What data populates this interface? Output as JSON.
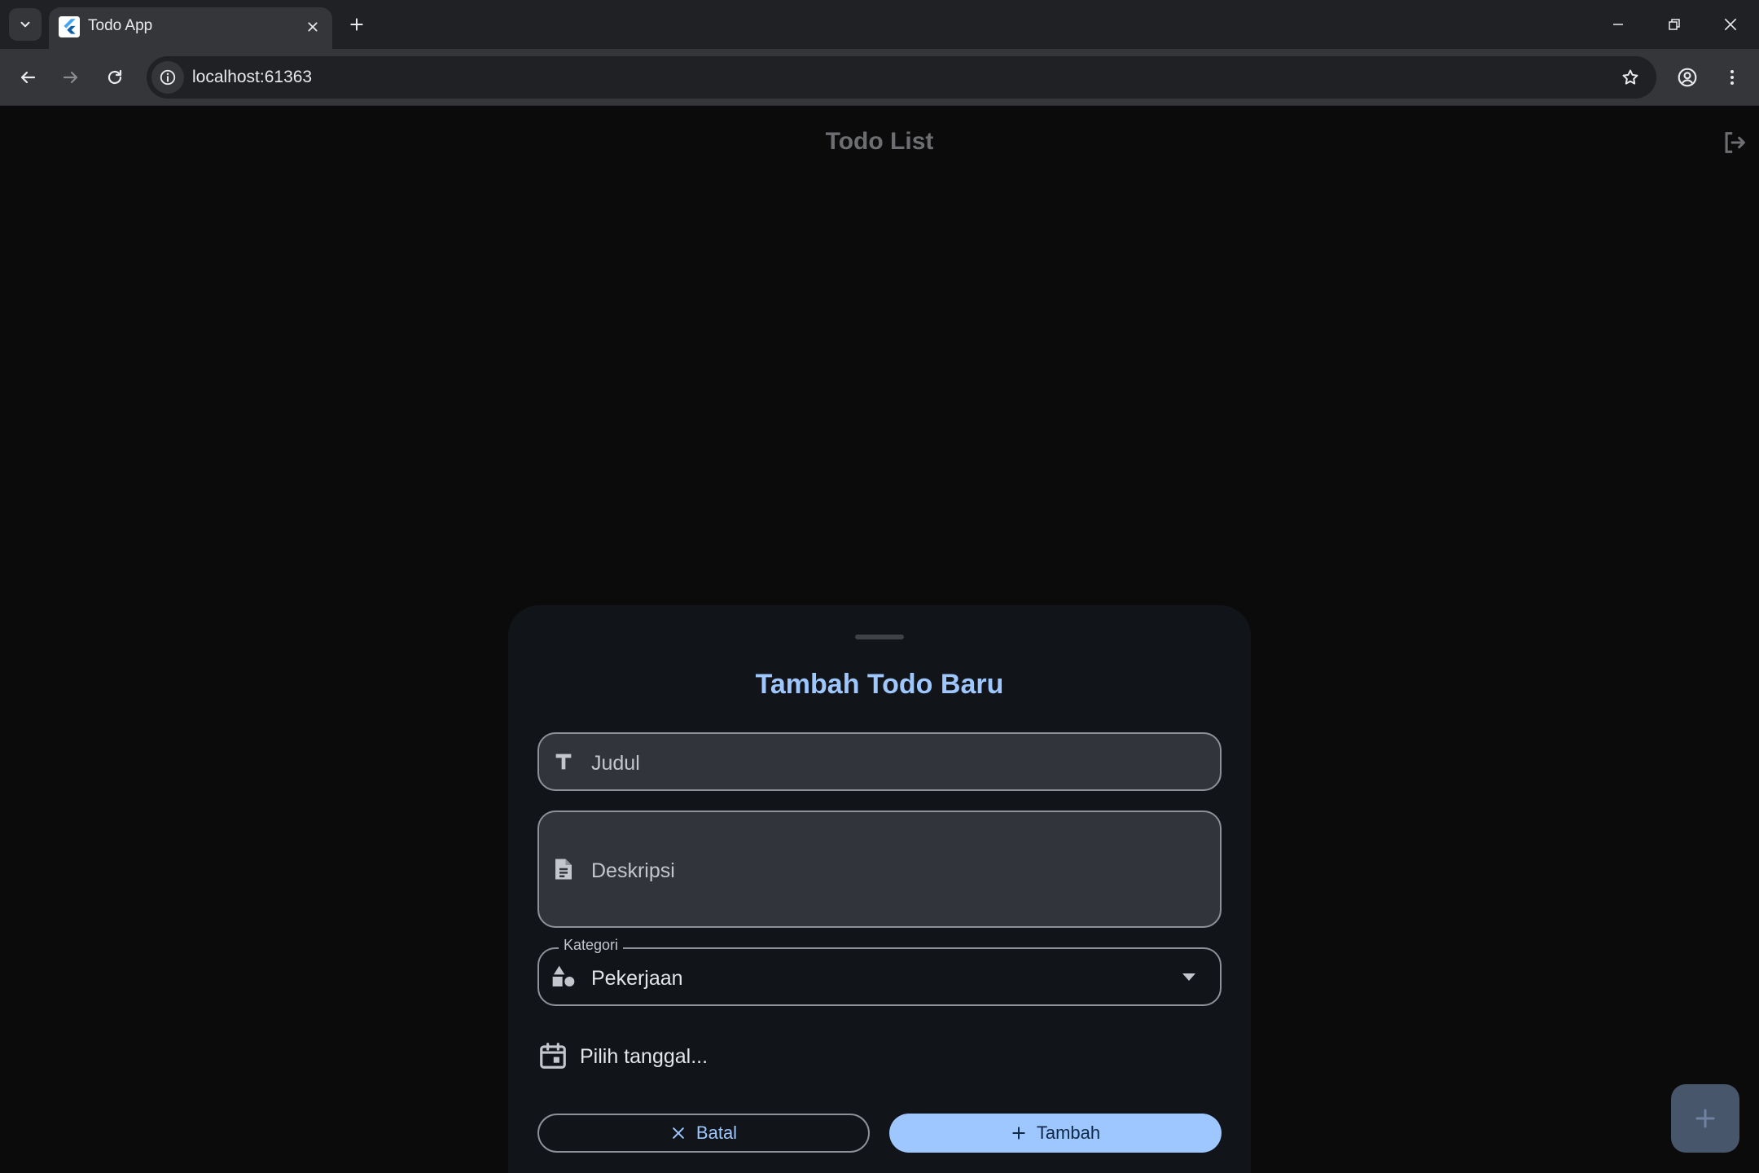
{
  "browser": {
    "tab_title": "Todo App",
    "url": "localhost:61363"
  },
  "app": {
    "title": "Todo List",
    "sheet": {
      "title": "Tambah Todo Baru",
      "title_field": {
        "placeholder": "Judul",
        "icon": "title-icon"
      },
      "description_field": {
        "placeholder": "Deskripsi",
        "icon": "description-icon"
      },
      "category_field": {
        "label": "Kategori",
        "value": "Pekerjaan",
        "icon": "category-icon"
      },
      "date_picker": {
        "label": "Pilih tanggal...",
        "icon": "calendar-icon"
      },
      "cancel_label": "Batal",
      "add_label": "Tambah"
    }
  },
  "colors": {
    "accent": "#9ec6ff",
    "sheet_bg": "#111418",
    "field_bg": "#31353b",
    "fab_bg": "#48566b"
  }
}
